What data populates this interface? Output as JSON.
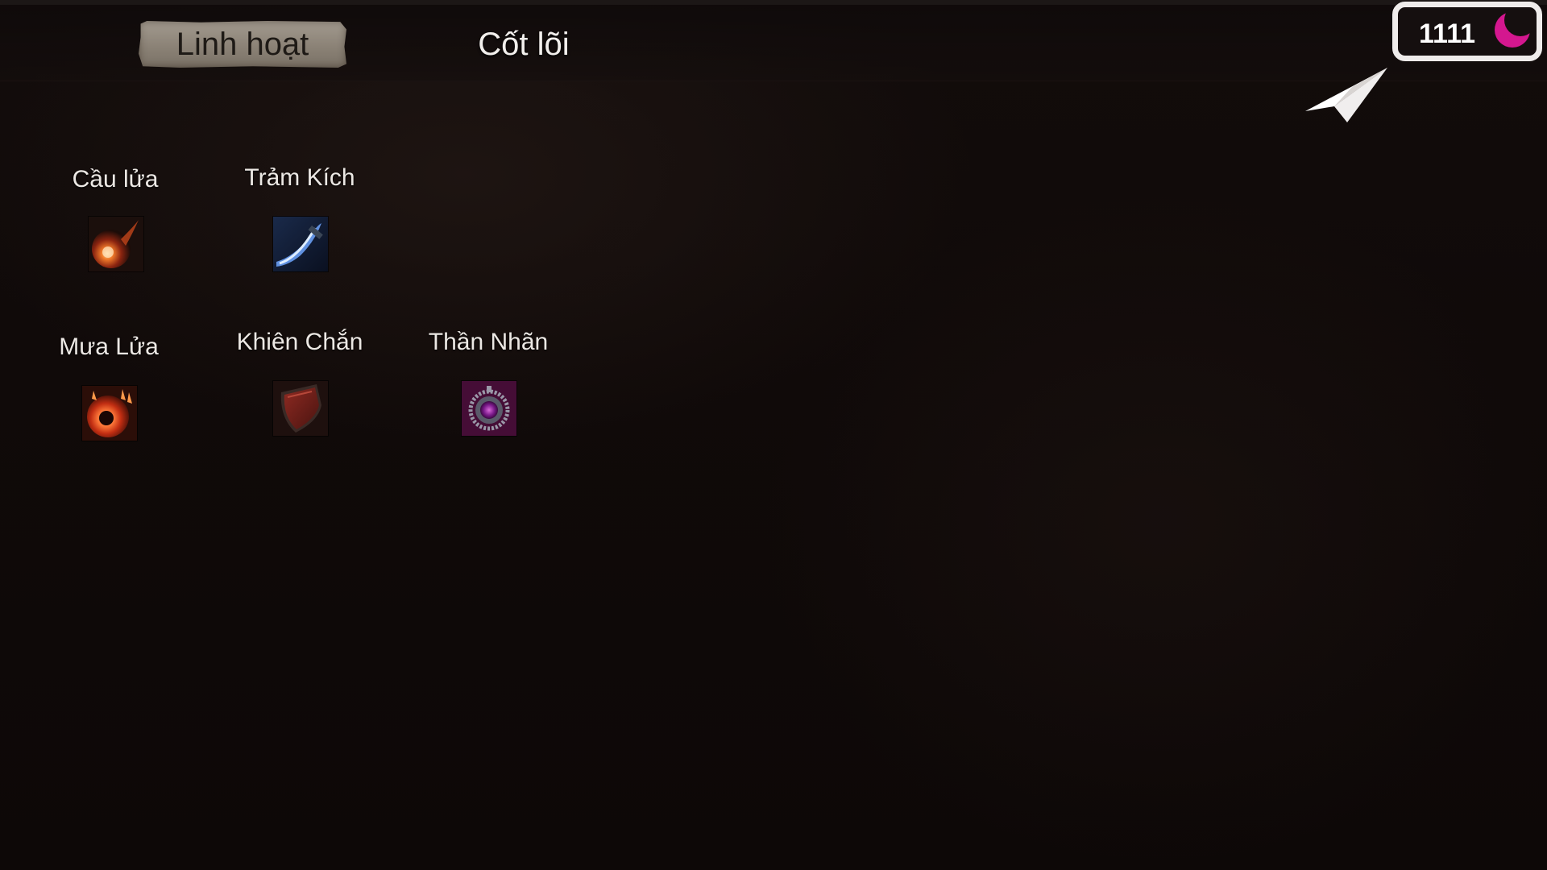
{
  "tabs": {
    "active_label": "Linh hoạt",
    "inactive_label": "Cốt lõi"
  },
  "currency": {
    "value": "1111",
    "icon": "magenta-crescent-icon",
    "color": "#d4178f"
  },
  "navigation": {
    "icon": "paper-plane-arrow-icon"
  },
  "skills": [
    {
      "label": "Cầu lửa",
      "icon": "fireball-icon"
    },
    {
      "label": "Trảm Kích",
      "icon": "blue-slash-icon"
    },
    {
      "label": "Mưa Lửa",
      "icon": "fire-rain-icon"
    },
    {
      "label": "Khiên Chắn",
      "icon": "red-shield-icon"
    },
    {
      "label": "Thần Nhãn",
      "icon": "purple-amulet-icon"
    }
  ]
}
